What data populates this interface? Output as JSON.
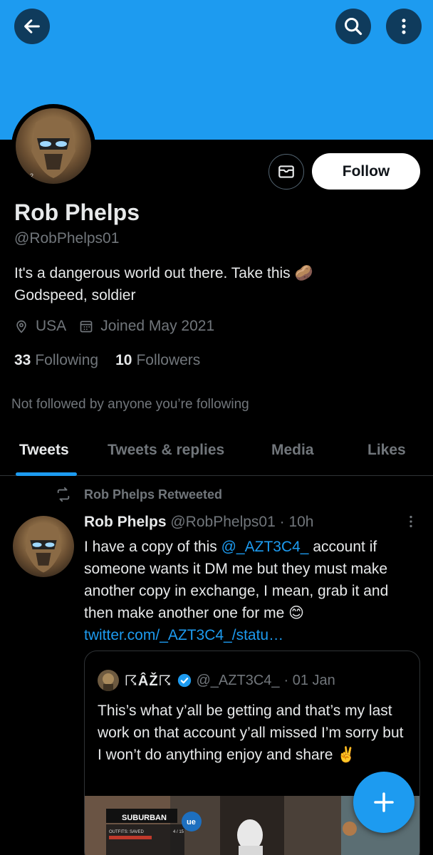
{
  "colors": {
    "accent": "#1d9bf0",
    "background": "#000000",
    "follow_button_bg": "#ffffff"
  },
  "header": {
    "back_icon": "arrow-left-icon",
    "search_icon": "search-icon",
    "more_icon": "more-vertical-icon"
  },
  "profile": {
    "avatar_badge": "2",
    "name": "Rob Phelps",
    "handle": "@RobPhelps01",
    "bio_line1": "It's a dangerous world out there. Take this 🥔",
    "bio_line2": "Godspeed, soldier",
    "location": "USA",
    "joined": "Joined May 2021",
    "following_count": "33",
    "following_label": "Following",
    "followers_count": "10",
    "followers_label": "Followers",
    "not_followed": "Not followed by anyone you’re following",
    "message_icon": "mail-icon",
    "follow_label": "Follow"
  },
  "tabs": [
    {
      "label": "Tweets",
      "active": true
    },
    {
      "label": "Tweets & replies",
      "active": false
    },
    {
      "label": "Media",
      "active": false
    },
    {
      "label": "Likes",
      "active": false
    }
  ],
  "tweet": {
    "retweet_label": "Rob Phelps Retweeted",
    "author_name": "Rob Phelps",
    "author_handle": "@RobPhelps01",
    "time": "· 10h",
    "text_before": "I have a copy of this ",
    "mention": "@_AZT3C4_",
    "text_after": " account if someone wants it DM me but they must make another copy in exchange, I mean, grab it and then make another one for me 😊",
    "link": "twitter.com/_AZT3C4_/statu…",
    "quote": {
      "display_name": "☈ÂŽ☈",
      "handle": "@_AZT3C4_",
      "date": "· 01 Jan",
      "text": "This’s what y’all be getting and that’s my last work on that account y’all missed I’m sorry but I won’t do anything enjoy and share ✌️",
      "media_text_1": "SUBURBAN",
      "media_text_2": "OUTFITS: SAVED",
      "media_text_3": "4 / 15",
      "media_badge": "ue"
    }
  },
  "fab": {
    "icon": "plus-icon"
  }
}
